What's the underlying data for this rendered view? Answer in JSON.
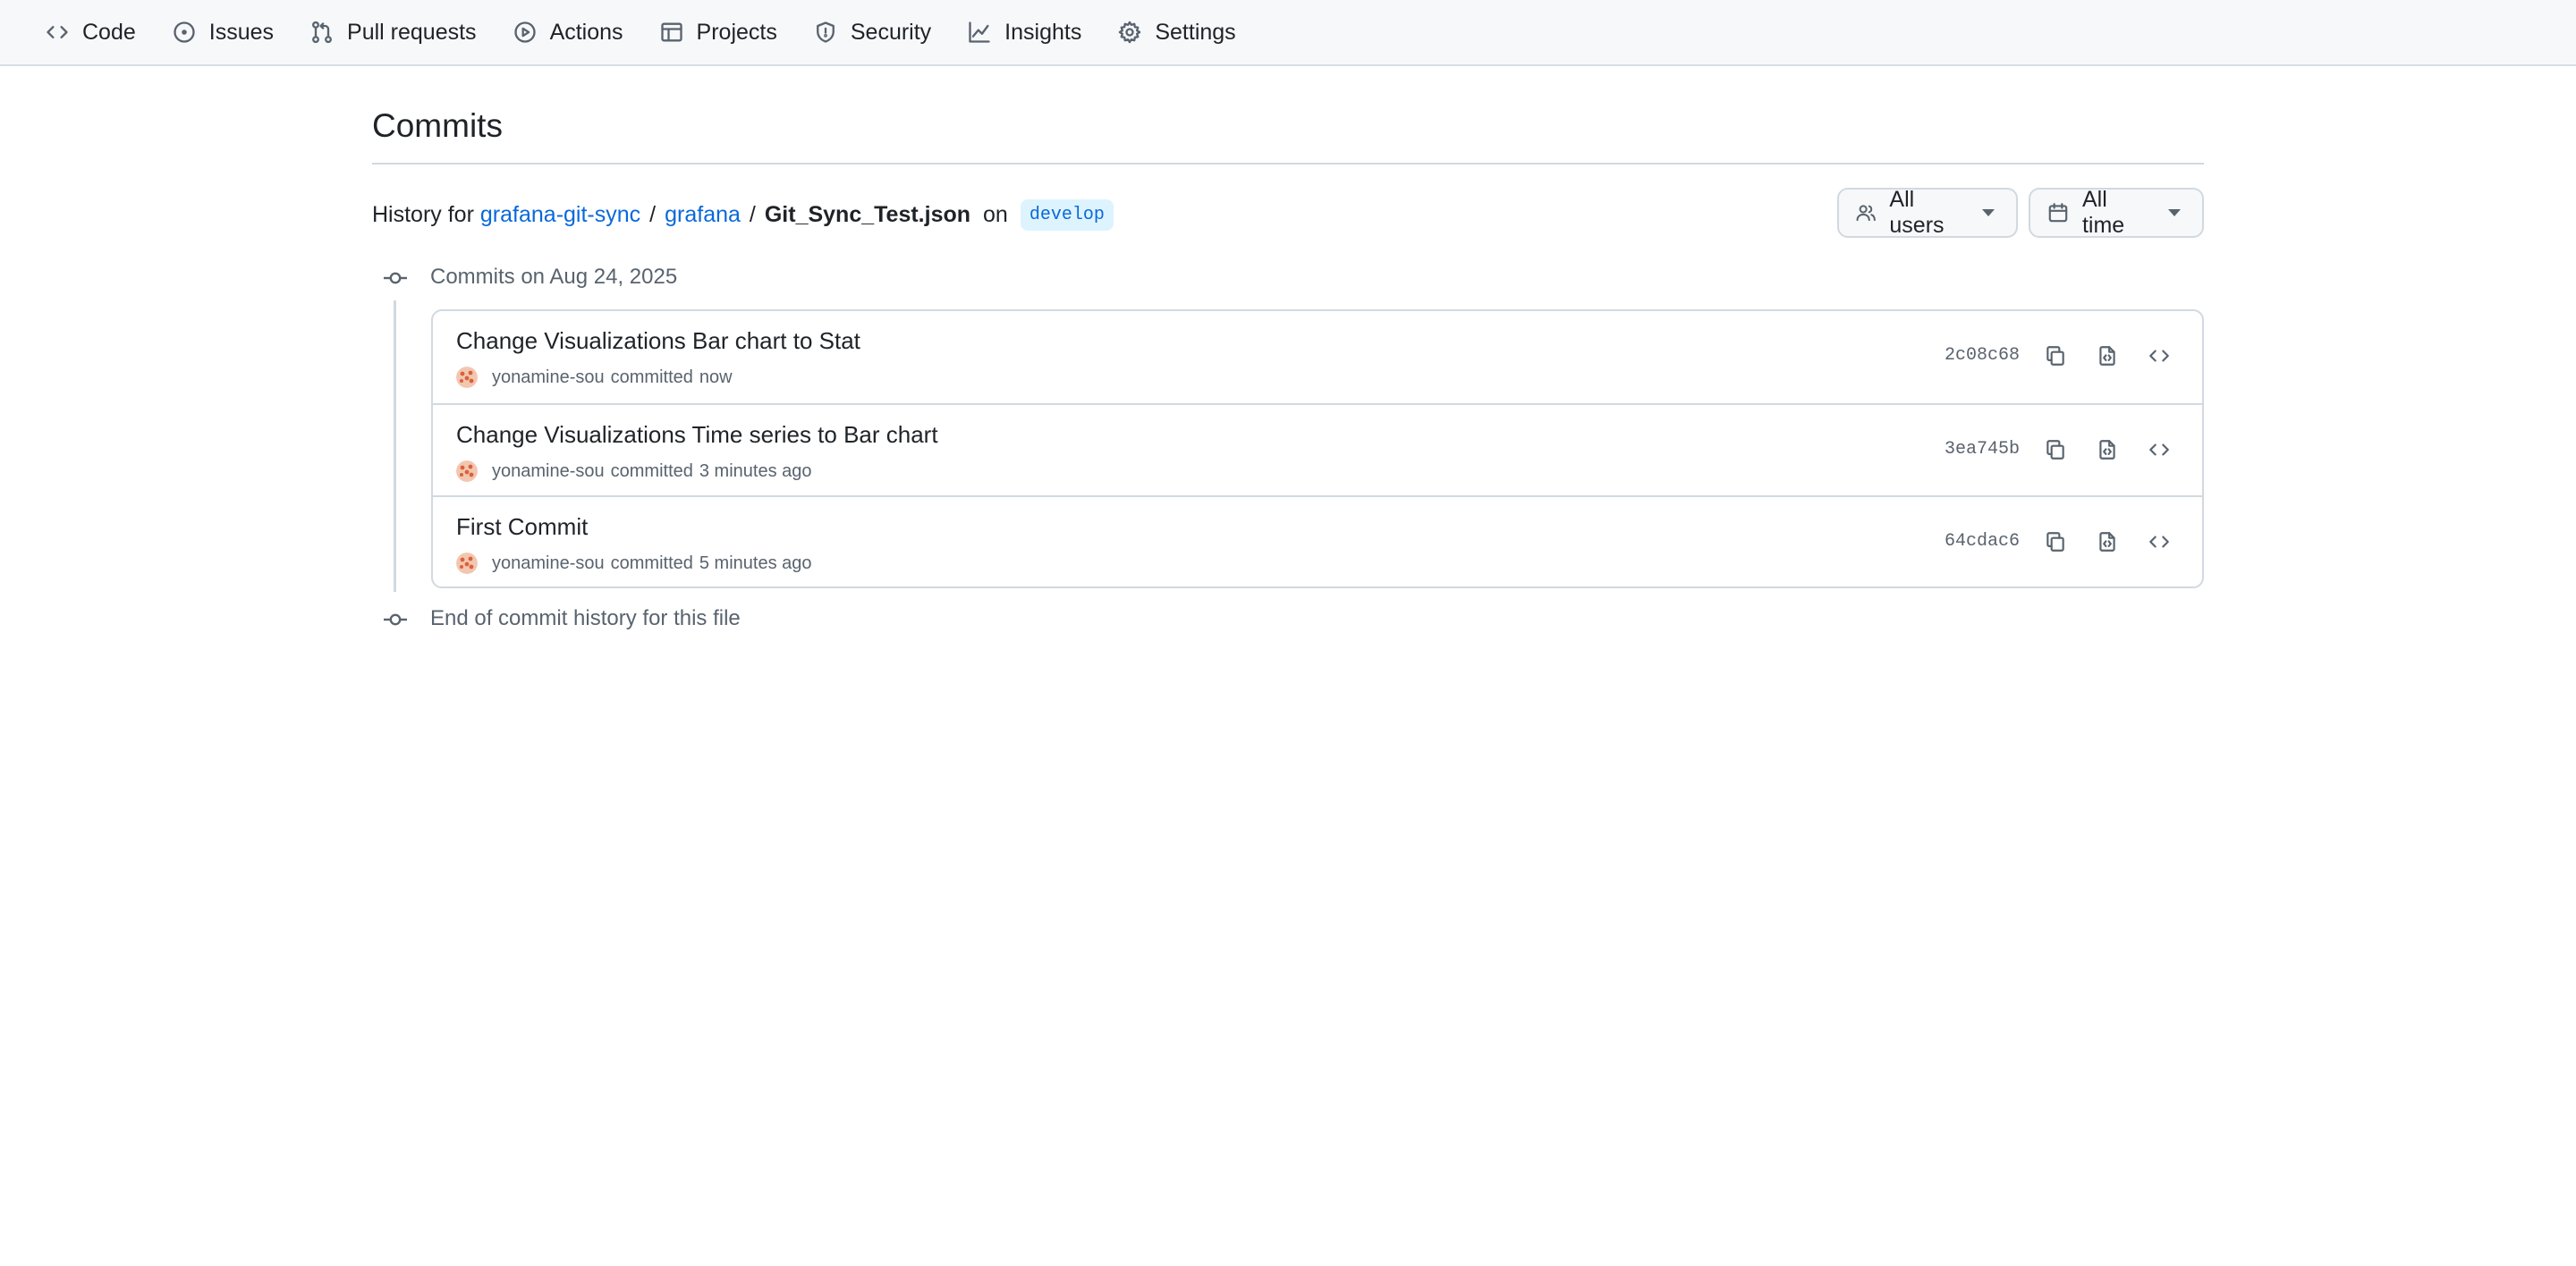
{
  "nav": {
    "items": [
      {
        "label": "Code",
        "icon": "code-icon"
      },
      {
        "label": "Issues",
        "icon": "issue-opened-icon"
      },
      {
        "label": "Pull requests",
        "icon": "git-pull-request-icon"
      },
      {
        "label": "Actions",
        "icon": "play-icon"
      },
      {
        "label": "Projects",
        "icon": "table-icon"
      },
      {
        "label": "Security",
        "icon": "shield-icon"
      },
      {
        "label": "Insights",
        "icon": "graph-icon"
      },
      {
        "label": "Settings",
        "icon": "gear-icon"
      }
    ]
  },
  "page": {
    "title": "Commits",
    "history_prefix": "History for",
    "breadcrumb": [
      "grafana-git-sync",
      "grafana",
      "Git_Sync_Test.json"
    ],
    "breadcrumb_sep": "/",
    "on_word": "on",
    "branch": "develop"
  },
  "filters": {
    "users_label": "All users",
    "time_label": "All time"
  },
  "timeline": {
    "group_heading": "Commits on Aug 24, 2025",
    "end_text": "End of commit history for this file",
    "commits": [
      {
        "title": "Change Visualizations Bar chart to Stat",
        "author": "yonamine-sou",
        "action": "committed",
        "when": "now",
        "sha": "2c08c68"
      },
      {
        "title": "Change Visualizations Time series to Bar chart",
        "author": "yonamine-sou",
        "action": "committed",
        "when": "3 minutes ago",
        "sha": "3ea745b"
      },
      {
        "title": "First Commit",
        "author": "yonamine-sou",
        "action": "committed",
        "when": "5 minutes ago",
        "sha": "64cdac6"
      }
    ]
  },
  "colors": {
    "link": "#0969da",
    "muted": "#59636e",
    "border": "#d1d9e0",
    "nav_bg": "#f6f8fa",
    "branch_bg": "#ddf4ff"
  }
}
